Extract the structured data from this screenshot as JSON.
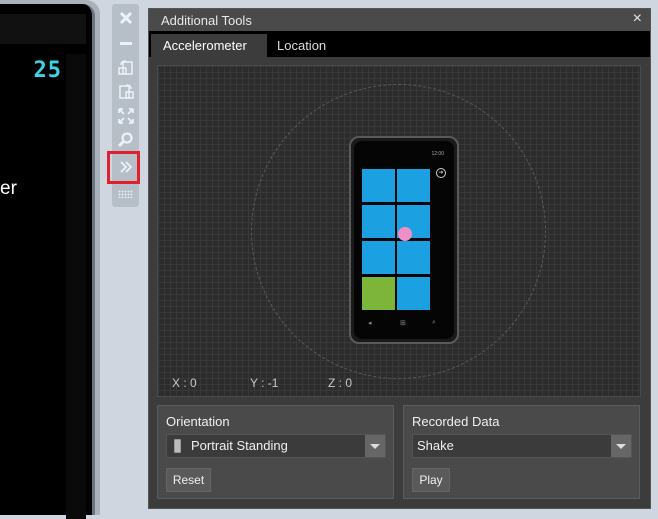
{
  "emulator": {
    "clock": "25",
    "partial_text": "er"
  },
  "toolbar": {
    "buttons": [
      {
        "name": "close-icon"
      },
      {
        "name": "minimize-icon"
      },
      {
        "name": "rotate-left-icon"
      },
      {
        "name": "rotate-right-icon"
      },
      {
        "name": "fit-to-screen-icon"
      },
      {
        "name": "zoom-icon"
      },
      {
        "name": "additional-tools-icon"
      }
    ]
  },
  "panel": {
    "title": "Additional Tools",
    "close": "×",
    "tabs": [
      {
        "label": "Accelerometer",
        "active": true
      },
      {
        "label": "Location",
        "active": false
      }
    ],
    "readouts": {
      "x": "X : 0",
      "y": "Y : -1",
      "z": "Z : 0"
    },
    "phone": {
      "time": "12:00"
    },
    "orientation": {
      "label": "Orientation",
      "selected": "Portrait Standing",
      "reset": "Reset"
    },
    "recorded": {
      "label": "Recorded Data",
      "selected": "Shake",
      "play": "Play"
    }
  },
  "colors": {
    "tile_blue": "#1ba1e2",
    "tile_green": "#7db53a",
    "dot_pink": "#ee90c7",
    "clock_cyan": "#39d7e6",
    "highlight_red": "#e0202a"
  }
}
